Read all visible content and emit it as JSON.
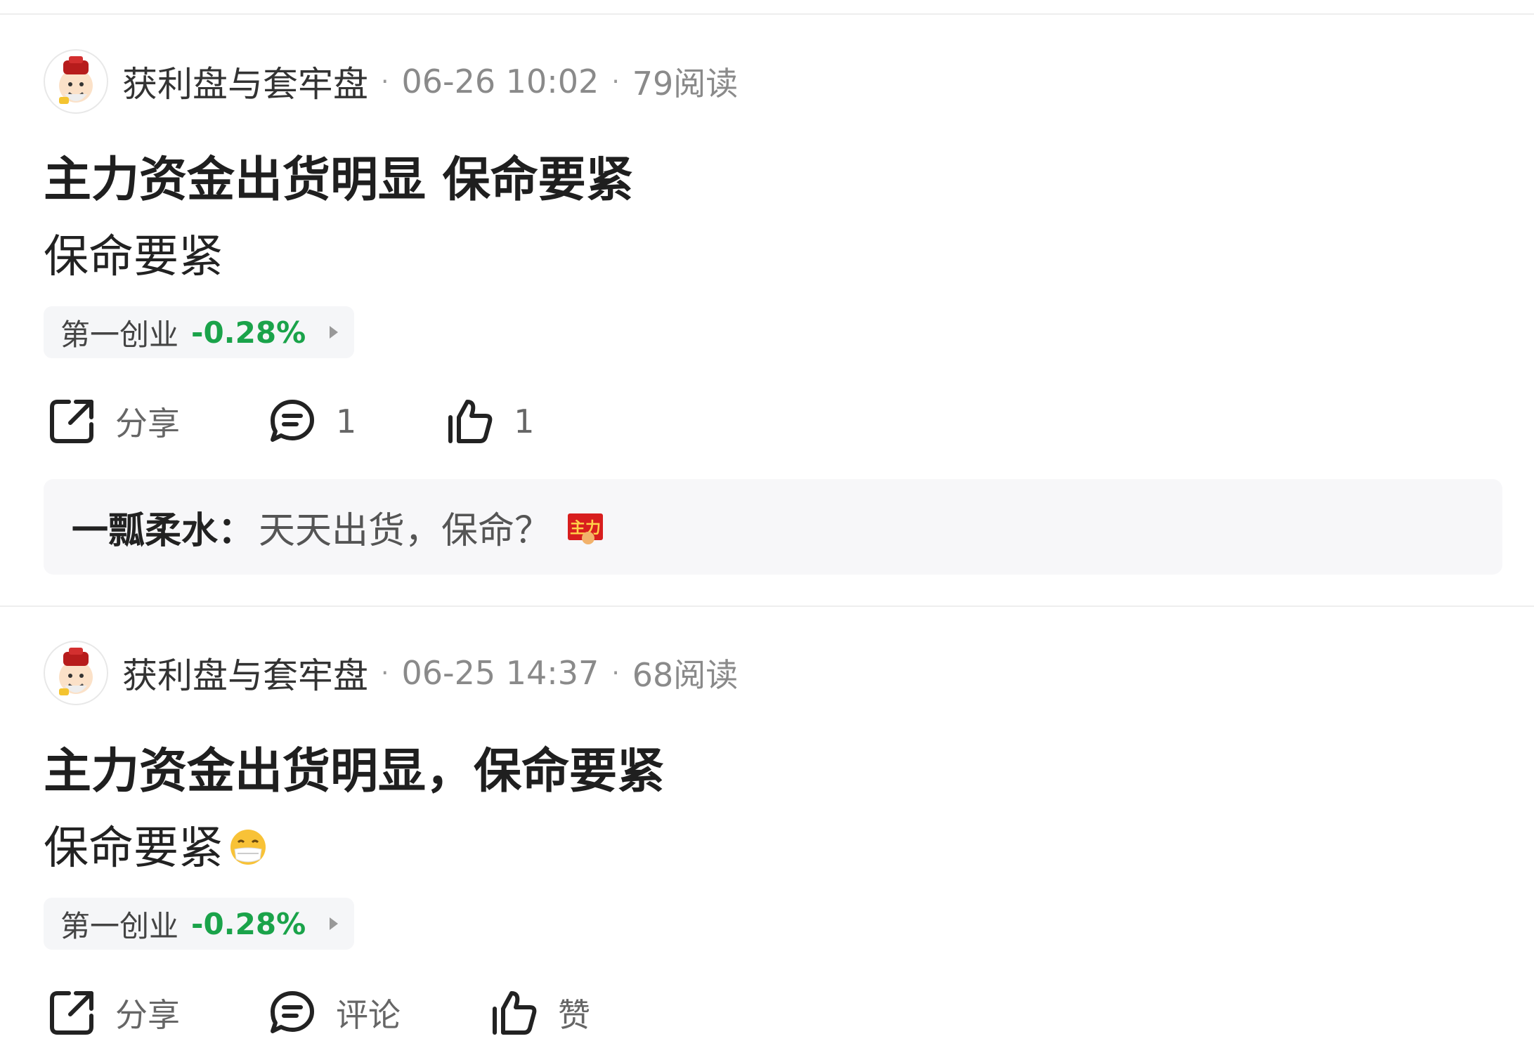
{
  "posts": [
    {
      "author": "获利盘与套牢盘",
      "date": "06-26 10:02",
      "reads": "79阅读",
      "title": "主力资金出货明显 保命要紧",
      "body": "保命要紧",
      "stock": {
        "name": "第一创业",
        "change": "-0.28%"
      },
      "actions": {
        "share": "分享",
        "comments": "1",
        "likes": "1"
      },
      "comment": {
        "author": "一瓢柔水：",
        "text": "天天出货，保命？",
        "sticker_text": "主力"
      }
    },
    {
      "author": "获利盘与套牢盘",
      "date": "06-25 14:37",
      "reads": "68阅读",
      "title": "主力资金出货明显，保命要紧",
      "body": "保命要紧",
      "stock": {
        "name": "第一创业",
        "change": "-0.28%"
      },
      "actions": {
        "share": "分享",
        "comments": "评论",
        "likes": "赞"
      }
    }
  ],
  "meta_separator": "·",
  "colors": {
    "stock_down": "#1aa34a",
    "divider": "#eeeeee",
    "chip_bg": "#f5f6f8"
  },
  "icons": [
    "share-icon",
    "comment-icon",
    "like-icon",
    "avatar-icon",
    "mask-face-emoji"
  ]
}
